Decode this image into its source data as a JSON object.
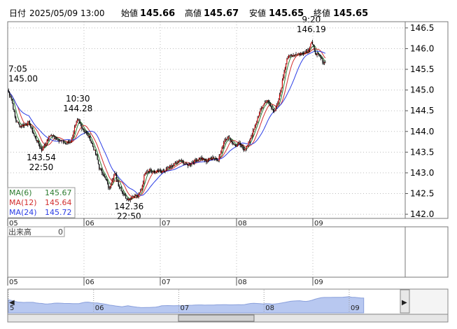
{
  "header": {
    "label_time": "日付",
    "datetime": "2025/05/09 13:00",
    "label_open": "始値",
    "open": "145.66",
    "label_high": "高値",
    "high": "145.67",
    "label_low": "安値",
    "low": "145.65",
    "label_close": "終値",
    "close": "145.65"
  },
  "colors": {
    "up": "#cc0000",
    "down": "#000000",
    "ma6": "#2e7d32",
    "ma12": "#d32f2f",
    "ma24": "#2c3ee6",
    "high_value": "#e00000",
    "low_value": "#008000",
    "volume_fill": "#b8c8f0",
    "navigator_line": "#8aa0dc"
  },
  "indicators": {
    "ma6_label": "MA(6)",
    "ma6_value": "145.67",
    "ma12_label": "MA(12)",
    "ma12_value": "145.64",
    "ma24_label": "MA(24)",
    "ma24_value": "145.72",
    "volume_label": "出来高",
    "volume_value": "0"
  },
  "chart_data": {
    "type": "candlestick",
    "interval": "5min",
    "ylim": [
      141.9,
      146.65
    ],
    "yticks": [
      "146.5",
      "146.0",
      "145.5",
      "145.0",
      "144.5",
      "144.0",
      "143.5",
      "143.0",
      "142.5",
      "142.0"
    ],
    "yticks_values": [
      146.5,
      146.0,
      145.5,
      145.0,
      144.5,
      144.0,
      143.5,
      143.0,
      142.5,
      142.0
    ],
    "xticks": [
      "05",
      "06",
      "07",
      "08",
      "09"
    ],
    "xticks_values": [
      0,
      1,
      2,
      3,
      4
    ],
    "x_range": [
      0,
      4.7
    ],
    "price_path": [
      [
        0.0,
        145.0
      ],
      [
        0.05,
        144.78
      ],
      [
        0.1,
        144.3
      ],
      [
        0.16,
        144.13
      ],
      [
        0.22,
        144.16
      ],
      [
        0.28,
        144.22
      ],
      [
        0.32,
        144.02
      ],
      [
        0.36,
        143.84
      ],
      [
        0.4,
        143.73
      ],
      [
        0.44,
        143.54
      ],
      [
        0.5,
        143.72
      ],
      [
        0.56,
        143.92
      ],
      [
        0.62,
        143.86
      ],
      [
        0.66,
        143.8
      ],
      [
        0.71,
        143.76
      ],
      [
        0.76,
        143.71
      ],
      [
        0.83,
        143.76
      ],
      [
        0.87,
        144.05
      ],
      [
        0.92,
        144.28
      ],
      [
        0.97,
        144.1
      ],
      [
        1.02,
        143.98
      ],
      [
        1.07,
        143.86
      ],
      [
        1.12,
        143.62
      ],
      [
        1.17,
        143.36
      ],
      [
        1.2,
        143.12
      ],
      [
        1.25,
        142.98
      ],
      [
        1.3,
        142.78
      ],
      [
        1.33,
        142.6
      ],
      [
        1.37,
        142.86
      ],
      [
        1.41,
        142.98
      ],
      [
        1.45,
        142.72
      ],
      [
        1.5,
        142.55
      ],
      [
        1.55,
        142.4
      ],
      [
        1.59,
        142.36
      ],
      [
        1.65,
        142.45
      ],
      [
        1.71,
        142.44
      ],
      [
        1.75,
        142.58
      ],
      [
        1.8,
        143.02
      ],
      [
        1.86,
        143.08
      ],
      [
        1.92,
        143.0
      ],
      [
        1.97,
        143.05
      ],
      [
        2.02,
        143.0
      ],
      [
        2.1,
        143.1
      ],
      [
        2.18,
        143.2
      ],
      [
        2.26,
        143.3
      ],
      [
        2.35,
        143.18
      ],
      [
        2.44,
        143.28
      ],
      [
        2.52,
        143.36
      ],
      [
        2.6,
        143.28
      ],
      [
        2.68,
        143.38
      ],
      [
        2.76,
        143.32
      ],
      [
        2.8,
        143.54
      ],
      [
        2.84,
        143.8
      ],
      [
        2.89,
        143.86
      ],
      [
        2.94,
        143.76
      ],
      [
        2.99,
        143.64
      ],
      [
        3.04,
        143.7
      ],
      [
        3.09,
        143.56
      ],
      [
        3.14,
        143.64
      ],
      [
        3.19,
        143.88
      ],
      [
        3.24,
        144.1
      ],
      [
        3.29,
        144.4
      ],
      [
        3.34,
        144.62
      ],
      [
        3.4,
        144.76
      ],
      [
        3.45,
        144.58
      ],
      [
        3.5,
        144.5
      ],
      [
        3.54,
        144.66
      ],
      [
        3.58,
        145.0
      ],
      [
        3.62,
        145.42
      ],
      [
        3.66,
        145.76
      ],
      [
        3.7,
        145.82
      ],
      [
        3.75,
        145.85
      ],
      [
        3.8,
        145.88
      ],
      [
        3.85,
        145.88
      ],
      [
        3.9,
        145.92
      ],
      [
        3.95,
        145.98
      ],
      [
        3.98,
        146.19
      ],
      [
        4.02,
        145.94
      ],
      [
        4.06,
        145.84
      ],
      [
        4.1,
        145.78
      ],
      [
        4.14,
        145.66
      ],
      [
        4.17,
        145.65
      ]
    ],
    "annotations": [
      {
        "time": "7:05",
        "price": "145.00",
        "x": 0.0,
        "y": 145.0,
        "position": "above"
      },
      {
        "time": "10:30",
        "price": "144.28",
        "x": 0.92,
        "y": 144.28,
        "position": "above"
      },
      {
        "time": "22:50",
        "price": "143.54",
        "x": 0.44,
        "y": 143.54,
        "position": "below"
      },
      {
        "time": "22:50",
        "price": "142.36",
        "x": 1.59,
        "y": 142.36,
        "position": "below"
      },
      {
        "time": "9:20",
        "price": "146.19",
        "x": 3.98,
        "y": 146.19,
        "position": "above"
      }
    ],
    "series": [
      {
        "name": "MA(6)",
        "last": 145.67
      },
      {
        "name": "MA(12)",
        "last": 145.64
      },
      {
        "name": "MA(24)",
        "last": 145.72
      }
    ],
    "volume": {
      "last": 0
    }
  },
  "navigator": {
    "ticks": [
      "5",
      "06",
      "07",
      "08",
      "09"
    ],
    "ticks_values": [
      0,
      1,
      2,
      3,
      4
    ],
    "left_arrow": "◀",
    "right_arrow": "▶"
  }
}
